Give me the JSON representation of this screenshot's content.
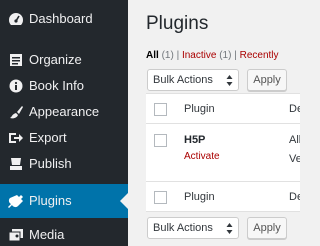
{
  "sidebar": {
    "items": [
      {
        "label": "Dashboard",
        "icon": "dashboard-icon"
      },
      {
        "label": "Organize",
        "icon": "organize-icon"
      },
      {
        "label": "Book Info",
        "icon": "info-icon"
      },
      {
        "label": "Appearance",
        "icon": "paintbrush-icon"
      },
      {
        "label": "Export",
        "icon": "export-icon"
      },
      {
        "label": "Publish",
        "icon": "publish-icon"
      },
      {
        "label": "Plugins",
        "icon": "plugins-icon",
        "current": true
      },
      {
        "label": "Media",
        "icon": "media-icon"
      }
    ],
    "colors": {
      "background": "#23282d",
      "current": "#0073aa"
    }
  },
  "main": {
    "title": "Plugins",
    "filters": {
      "all_label": "All",
      "all_count": "(1)",
      "sep1": "|",
      "inactive_label": "Inactive",
      "inactive_count": "(1)",
      "sep2": "|",
      "recently_label": "Recently"
    },
    "bulk_top": {
      "select_value": "Bulk Actions",
      "apply": "Apply"
    },
    "bulk_bottom": {
      "select_value": "Bulk Actions",
      "apply": "Apply"
    },
    "table": {
      "header": {
        "plugin": "Plugin",
        "description": "De"
      },
      "rows": [
        {
          "name": "H5P",
          "action": "Activate",
          "desc_line1": "Allo",
          "desc_line2": "Ver"
        }
      ],
      "footer": {
        "plugin": "Plugin",
        "description": "De"
      }
    }
  }
}
